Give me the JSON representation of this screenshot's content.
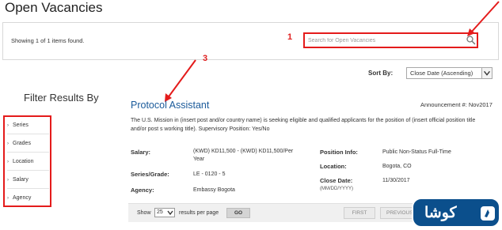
{
  "page": {
    "title": "Open Vacancies"
  },
  "results": {
    "showing": "Showing 1 of 1 items found."
  },
  "search": {
    "placeholder": "Search for Open Vacancies"
  },
  "sort": {
    "label": "Sort By:",
    "selected": "Close Date (Ascending)"
  },
  "filters": {
    "title": "Filter Results By",
    "items": [
      {
        "label": "Series"
      },
      {
        "label": "Grades"
      },
      {
        "label": "Location"
      },
      {
        "label": "Salary"
      },
      {
        "label": "Agency"
      }
    ]
  },
  "job": {
    "title": "Protocol Assistant",
    "announcement": "Announcement #: Nov2017",
    "description": "The U.S. Mission in (insert post and/or country name) is seeking eligible and qualified applicants for the position of (insert official position title and/or post s working title). Supervisory Position: Yes/No",
    "salary_label": "Salary:",
    "salary_line1": "(KWD) KD11,500 - (KWD) KD11,500/Per",
    "salary_line2": "Year",
    "series_label": "Series/Grade:",
    "series_value": "LE - 0120 - 5",
    "agency_label": "Agency:",
    "agency_value": "Embassy Bogota",
    "position_info_label": "Position Info:",
    "position_info_value": "Public Non-Status Full-Time",
    "location_label": "Location:",
    "location_value": "Bogota, CO",
    "close_date_label": "Close Date:",
    "close_date_format": "(MM/DD/YYYY)",
    "close_date_value": "11/30/2017"
  },
  "pager": {
    "show_label": "Show",
    "page_size": "25",
    "per_page_label": "results per page",
    "go_label": "GO",
    "first_label": "FIRST",
    "previous_label": "PREVIOUS"
  },
  "annotations": {
    "mark1": "1",
    "mark3": "3"
  },
  "watermark": {
    "text": "كوشا"
  },
  "colors": {
    "annotation": "#e41b1b",
    "link": "#1a5a9a",
    "logo_bg": "#0b4f8c"
  },
  "icons": {
    "search": "search-icon",
    "dropdown": "chevron-down-icon",
    "filter_chevron": "chevron-right-icon"
  }
}
